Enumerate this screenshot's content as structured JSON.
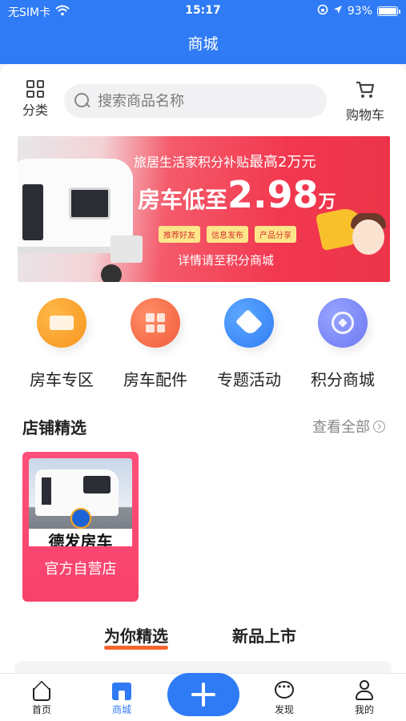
{
  "status_bar": {
    "carrier": "无SIM卡",
    "time": "15:17",
    "battery": "93%",
    "battery_level": 0.93
  },
  "nav": {
    "title": "商城"
  },
  "header": {
    "category_label": "分类",
    "search_placeholder": "搜索商品名称",
    "cart_label": "购物车"
  },
  "banner": {
    "line1": "旅居生活家积分补贴",
    "line1_emph": "最高2万元",
    "main_prefix": "房车低至",
    "main_number": "2.98",
    "main_unit": "万",
    "chips": [
      "推荐好友",
      "信息发布",
      "产品分享"
    ],
    "sub": "详情请至积分商城"
  },
  "quick_entries": [
    {
      "label": "房车专区",
      "icon": "rv-card-icon"
    },
    {
      "label": "房车配件",
      "icon": "parts-grid-icon"
    },
    {
      "label": "专题活动",
      "icon": "tag-icon"
    },
    {
      "label": "积分商城",
      "icon": "coin-icon"
    }
  ],
  "store_section": {
    "title": "店铺精选",
    "more": "查看全部",
    "stores": [
      {
        "name": "官方自营店",
        "watermark": "德发房车"
      }
    ]
  },
  "feed_tabs": [
    {
      "label": "为你精选",
      "active": true
    },
    {
      "label": "新品上市",
      "active": false
    }
  ],
  "tabbar": {
    "items": [
      {
        "label": "首页",
        "active": false
      },
      {
        "label": "商城",
        "active": true
      },
      {
        "label": "发现",
        "active": false
      },
      {
        "label": "我的",
        "active": false
      }
    ]
  },
  "colors": {
    "primary": "#2f7bf5",
    "accent": "#f5652f",
    "store_card": "#ff4f7a"
  }
}
